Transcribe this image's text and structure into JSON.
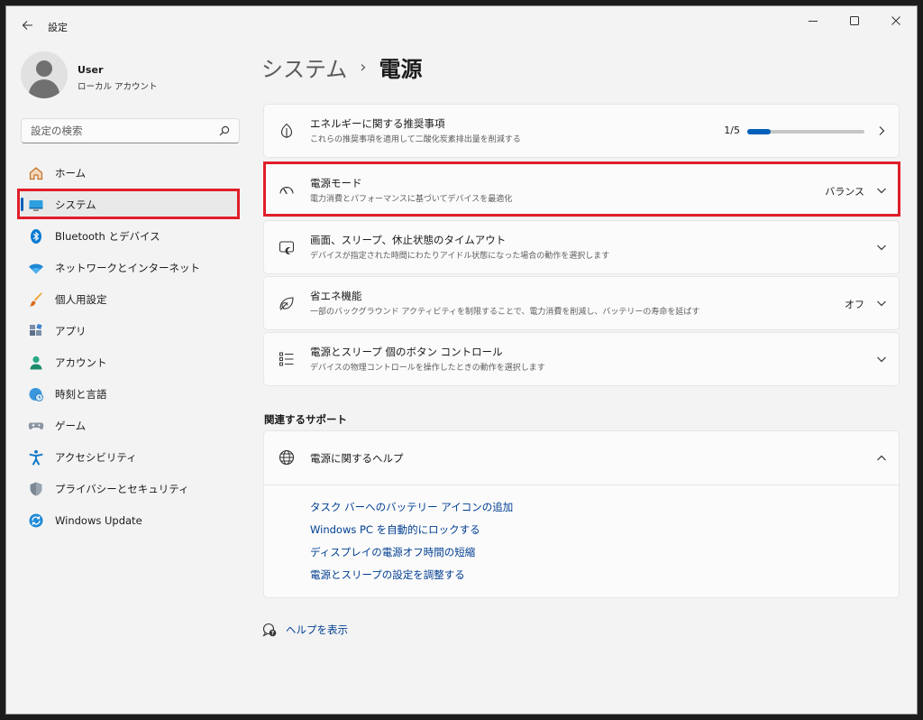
{
  "window": {
    "title": "設定",
    "controls": {
      "minimize": "minimize-icon",
      "maximize": "maximize-icon",
      "close": "close-icon"
    }
  },
  "profile": {
    "name": "User",
    "account_type": "ローカル アカウント"
  },
  "search": {
    "placeholder": "設定の検索"
  },
  "sidebar": {
    "items": [
      {
        "label": "ホーム",
        "icon": "home-icon"
      },
      {
        "label": "システム",
        "icon": "system-icon",
        "active": true
      },
      {
        "label": "Bluetooth とデバイス",
        "icon": "bluetooth-icon"
      },
      {
        "label": "ネットワークとインターネット",
        "icon": "wifi-icon"
      },
      {
        "label": "個人用設定",
        "icon": "brush-icon"
      },
      {
        "label": "アプリ",
        "icon": "apps-icon"
      },
      {
        "label": "アカウント",
        "icon": "account-icon"
      },
      {
        "label": "時刻と言語",
        "icon": "time-language-icon"
      },
      {
        "label": "ゲーム",
        "icon": "gamepad-icon"
      },
      {
        "label": "アクセシビリティ",
        "icon": "accessibility-icon"
      },
      {
        "label": "プライバシーとセキュリティ",
        "icon": "shield-icon"
      },
      {
        "label": "Windows Update",
        "icon": "update-icon"
      }
    ]
  },
  "breadcrumb": {
    "parent": "システム",
    "separator": "›",
    "current": "電源"
  },
  "settings": {
    "energy": {
      "title": "エネルギーに関する推奨事項",
      "desc": "これらの推奨事項を適用して二酸化炭素排出量を削減する",
      "progress_text": "1/5",
      "progress": 0.2
    },
    "power_mode": {
      "title": "電源モード",
      "desc": "電力消費とパフォーマンスに基づいてデバイスを最適化",
      "value": "バランス"
    },
    "screen_sleep": {
      "title": "画面、スリープ、休止状態のタイムアウト",
      "desc": "デバイスが指定された時間にわたりアイドル状態になった場合の動作を選択します"
    },
    "energy_saver": {
      "title": "省エネ機能",
      "desc": "一部のバックグラウンド アクティビティを制限することで、電力消費を削減し、バッテリーの寿命を延ばす",
      "value": "オフ"
    },
    "buttons": {
      "title": "電源とスリープ 個のボタン コントロール",
      "desc": "デバイスの物理コントロールを操作したときの動作を選択します"
    }
  },
  "related": {
    "section_title": "関連するサポート",
    "help_title": "電源に関するヘルプ",
    "links": [
      "タスク バーへのバッテリー アイコンの追加",
      "Windows PC を自動的にロックする",
      "ディスプレイの電源オフ時間の短縮",
      "電源とスリープの設定を調整する"
    ]
  },
  "footer": {
    "get_help": "ヘルプを表示"
  },
  "colors": {
    "accent": "#005fb8",
    "highlight": "#e01e2a",
    "link": "#003e92"
  }
}
